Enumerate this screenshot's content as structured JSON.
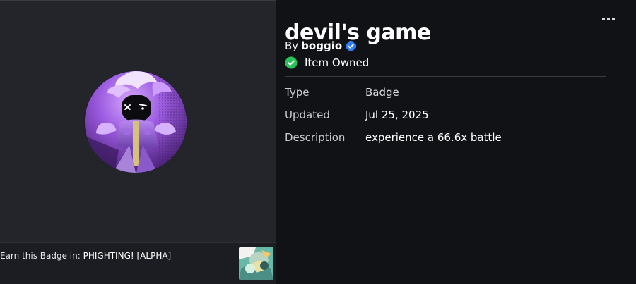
{
  "badge": {
    "title": "devil's game",
    "creator_prefix": "By",
    "creator_name": "boggio",
    "owned_status": "Item Owned"
  },
  "details": [
    {
      "label": "Type",
      "value": "Badge"
    },
    {
      "label": "Updated",
      "value": "Jul 25, 2025"
    },
    {
      "label": "Description",
      "value": "experience a 66.6x battle"
    }
  ],
  "earn": {
    "prefix": "Earn this Badge in: ",
    "game": "PHIGHTING! [ALPHA]"
  },
  "icons": {
    "more": "more-options-icon",
    "verified": "verified-badge-icon",
    "owned": "check-circle-icon",
    "badge_image": "badge-image",
    "game_thumbnail": "game-thumbnail-image"
  },
  "colors": {
    "background": "#111216",
    "panel": "#24252b",
    "verified": "#2f7cf6",
    "owned": "#2ac15b",
    "badge_purple": "#7d4cc0"
  }
}
